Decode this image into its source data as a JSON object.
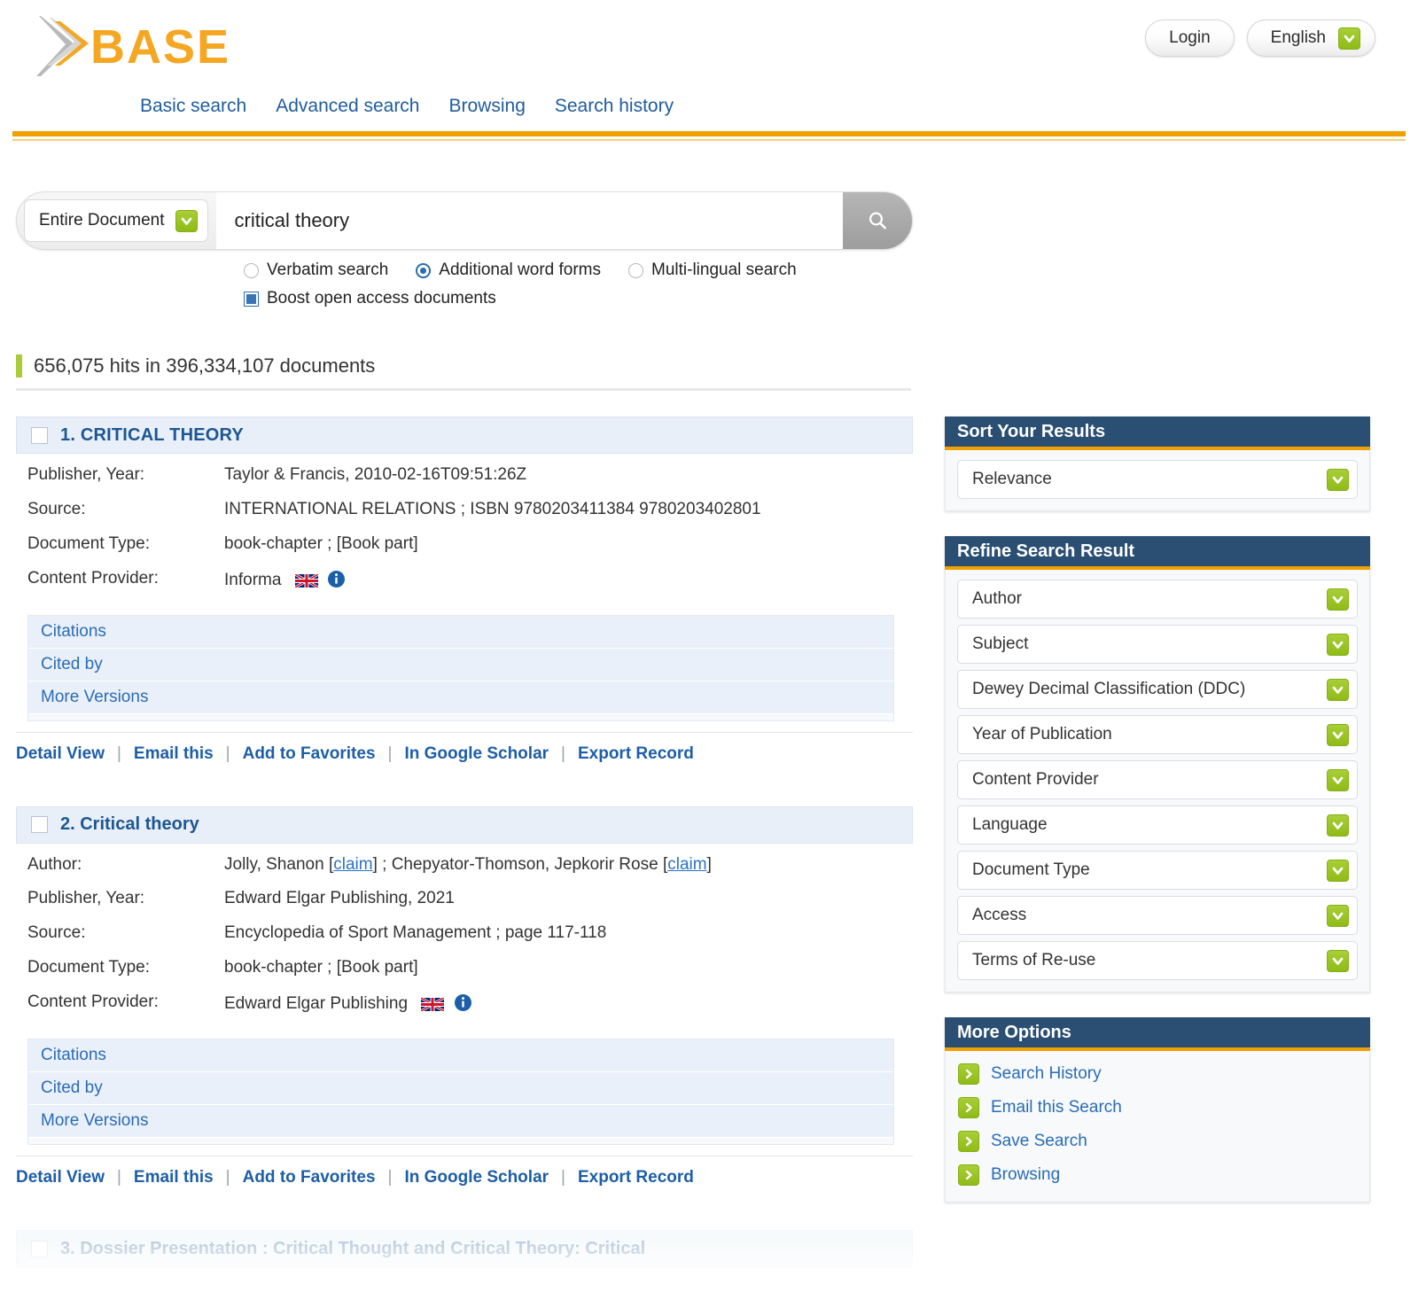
{
  "header": {
    "logo_text": "BASE",
    "login_label": "Login",
    "language_label": "English",
    "nav": [
      {
        "label": "Basic search"
      },
      {
        "label": "Advanced search"
      },
      {
        "label": "Browsing"
      },
      {
        "label": "Search history"
      }
    ]
  },
  "search": {
    "scope_value": "Entire Document",
    "query_value": "critical theory",
    "query_placeholder": "",
    "search_icon": "search-icon",
    "options": [
      {
        "label": "Verbatim search",
        "type": "radio",
        "checked": false
      },
      {
        "label": "Additional word forms",
        "type": "radio",
        "checked": true
      },
      {
        "label": "Multi-lingual search",
        "type": "radio",
        "checked": false
      }
    ],
    "boost": {
      "label": "Boost open access documents",
      "type": "checkbox",
      "checked": true
    }
  },
  "hits": {
    "text": "656,075 hits in 396,334,107 documents",
    "count": "656,075",
    "total_documents": "396,334,107",
    "accent_color": "#a9cc39"
  },
  "results": [
    {
      "number": "1.",
      "title": "1. CRITICAL THEORY",
      "fields": [
        {
          "label": "Publisher, Year:",
          "value": "Taylor & Francis, 2010-02-16T09:51:26Z"
        },
        {
          "label": "Source:",
          "value": "INTERNATIONAL RELATIONS ; ISBN 9780203411384 9780203402801"
        },
        {
          "label": "Document Type:",
          "value": "book-chapter ; [Book part]"
        },
        {
          "label": "Content Provider:",
          "value": "Informa",
          "has_flag": true,
          "has_info": true
        }
      ],
      "accordion": [
        "Citations",
        "Cited by",
        "More Versions"
      ],
      "actions": [
        "Detail View",
        "Email this",
        "Add to Favorites",
        "In Google Scholar",
        "Export Record"
      ]
    },
    {
      "number": "2.",
      "title": "2. Critical theory",
      "fields": [
        {
          "label": "Author:",
          "value": "Jolly, Shanon [claim] ; Chepyator-Thomson, Jepkorir Rose [claim]",
          "author_parts": [
            "Jolly, Shanon ",
            "claim",
            " ; Chepyator-Thomson, Jepkorir Rose ",
            "claim"
          ]
        },
        {
          "label": "Publisher, Year:",
          "value": "Edward Elgar Publishing, 2021"
        },
        {
          "label": "Source:",
          "value": "Encyclopedia of Sport Management ; page 117-118"
        },
        {
          "label": "Document Type:",
          "value": "book-chapter ; [Book part]"
        },
        {
          "label": "Content Provider:",
          "value": "Edward Elgar Publishing",
          "has_flag": true,
          "has_info": true
        }
      ],
      "accordion": [
        "Citations",
        "Cited by",
        "More Versions"
      ],
      "actions": [
        "Detail View",
        "Email this",
        "Add to Favorites",
        "In Google Scholar",
        "Export Record"
      ]
    },
    {
      "number": "3.",
      "title": "3. Dossier Presentation : Critical Thought and Critical Theory: Critical",
      "fields": [],
      "accordion": [],
      "actions": []
    }
  ],
  "sidebar": {
    "sort": {
      "title": "Sort Your Results",
      "selected": "Relevance"
    },
    "refine": {
      "title": "Refine Search Result",
      "facets": [
        {
          "label": "Author"
        },
        {
          "label": "Subject"
        },
        {
          "label": "Dewey Decimal Classification (DDC)"
        },
        {
          "label": "Year of Publication"
        },
        {
          "label": "Content Provider"
        },
        {
          "label": "Language"
        },
        {
          "label": "Document Type"
        },
        {
          "label": "Access"
        },
        {
          "label": "Terms of Re-use"
        }
      ]
    },
    "more_options": {
      "title": "More Options",
      "items": [
        {
          "label": "Search History"
        },
        {
          "label": "Email this Search"
        },
        {
          "label": "Save Search"
        },
        {
          "label": "Browsing"
        }
      ]
    }
  },
  "colors": {
    "brand_orange": "#f0a000",
    "panel_navy": "#2a4f73",
    "link_blue": "#1d5ea8",
    "accent_green": "#8fbb18"
  }
}
